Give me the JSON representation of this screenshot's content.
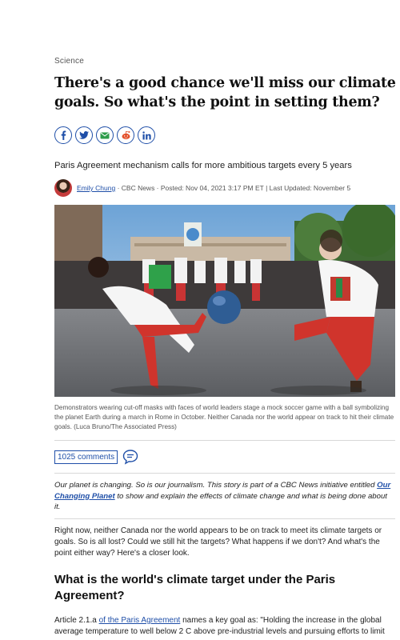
{
  "article": {
    "section": "Science",
    "headline": "There's a good chance we'll miss our climate goals. So what's the point in setting them?",
    "deck": "Paris Agreement mechanism calls for more ambitious targets every 5 years",
    "byline": {
      "author": "Emily Chung",
      "source": "· CBC News · Posted: Nov 04, 2021 3:17 PM ET | Last Updated: November 5"
    },
    "share_icons": [
      "facebook-icon",
      "twitter-icon",
      "email-icon",
      "reddit-icon",
      "linkedin-icon"
    ],
    "caption": "Demonstrators wearing cut-off masks with faces of world leaders stage a mock soccer game with a ball symbolizing the planet Earth during a march in Rome in October. Neither Canada nor the world appear on track to hit their climate goals. (Luca Bruno/The Associated Press)",
    "comments_label": "1025 comments",
    "initiative": {
      "before": "Our planet is changing. So is our journalism. This story is part of a CBC News initiative entitled ",
      "link": "Our Changing Planet",
      "after": " to show and explain the effects of climate change and what is being done about it."
    },
    "paragraph1": "Right now, neither Canada nor the world appears to be on track to meet its climate targets or goals. So is all lost? Could we still hit the targets? What happens if we don't? And what's the point either way? Here's a closer look.",
    "subheading": "What is the world's climate target under the Paris Agreement?",
    "paragraph2": {
      "before": "Article 2.1.a ",
      "link": "of the Paris Agreement",
      "after": " names a key goal as: \"Holding the increase in the global average temperature to well below 2 C above pre-industrial levels and pursuing efforts to limit"
    }
  },
  "colors": {
    "link": "#1f4fa8",
    "text": "#1c1c1c",
    "muted": "#555555"
  }
}
